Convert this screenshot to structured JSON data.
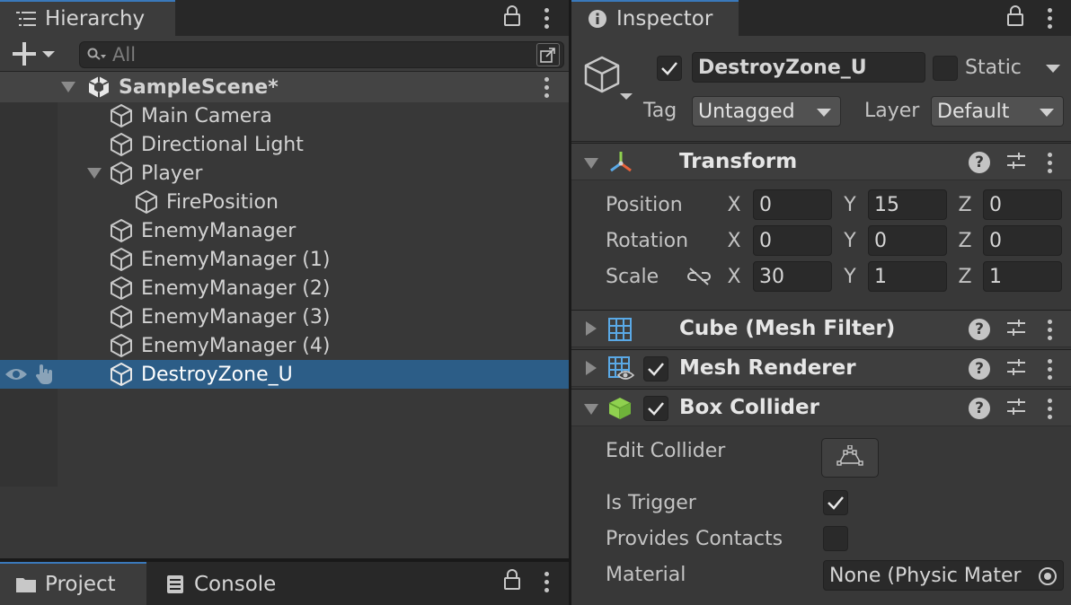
{
  "hierarchy": {
    "tab_label": "Hierarchy",
    "search_placeholder": "All",
    "scene": "SampleScene*",
    "items": [
      {
        "label": "Main Camera",
        "depth": 1
      },
      {
        "label": "Directional Light",
        "depth": 1
      },
      {
        "label": "Player",
        "depth": 1,
        "expanded": true
      },
      {
        "label": "FirePosition",
        "depth": 2
      },
      {
        "label": "EnemyManager",
        "depth": 1
      },
      {
        "label": "EnemyManager (1)",
        "depth": 1
      },
      {
        "label": "EnemyManager (2)",
        "depth": 1
      },
      {
        "label": "EnemyManager (3)",
        "depth": 1
      },
      {
        "label": "EnemyManager (4)",
        "depth": 1
      },
      {
        "label": "DestroyZone_U",
        "depth": 1,
        "selected": true
      }
    ]
  },
  "bottom_tabs": {
    "project": "Project",
    "console": "Console"
  },
  "inspector": {
    "tab_label": "Inspector",
    "object_name": "DestroyZone_U",
    "static_label": "Static",
    "tag_label": "Tag",
    "tag_value": "Untagged",
    "layer_label": "Layer",
    "layer_value": "Default",
    "transform": {
      "title": "Transform",
      "position_label": "Position",
      "rotation_label": "Rotation",
      "scale_label": "Scale",
      "position": {
        "x": "0",
        "y": "15",
        "z": "0"
      },
      "rotation": {
        "x": "0",
        "y": "0",
        "z": "0"
      },
      "scale": {
        "x": "30",
        "y": "1",
        "z": "1"
      },
      "axis_x": "X",
      "axis_y": "Y",
      "axis_z": "Z"
    },
    "mesh_filter": {
      "title": "Cube (Mesh Filter)"
    },
    "mesh_renderer": {
      "title": "Mesh Renderer"
    },
    "box_collider": {
      "title": "Box Collider",
      "edit_collider_label": "Edit Collider",
      "is_trigger_label": "Is Trigger",
      "provides_contacts_label": "Provides Contacts",
      "material_label": "Material",
      "material_value": "None (Physic Mater"
    }
  },
  "colors": {
    "selection": "#2c5d87",
    "accent_tab": "#3a79bb",
    "panel_bg": "#383838"
  }
}
